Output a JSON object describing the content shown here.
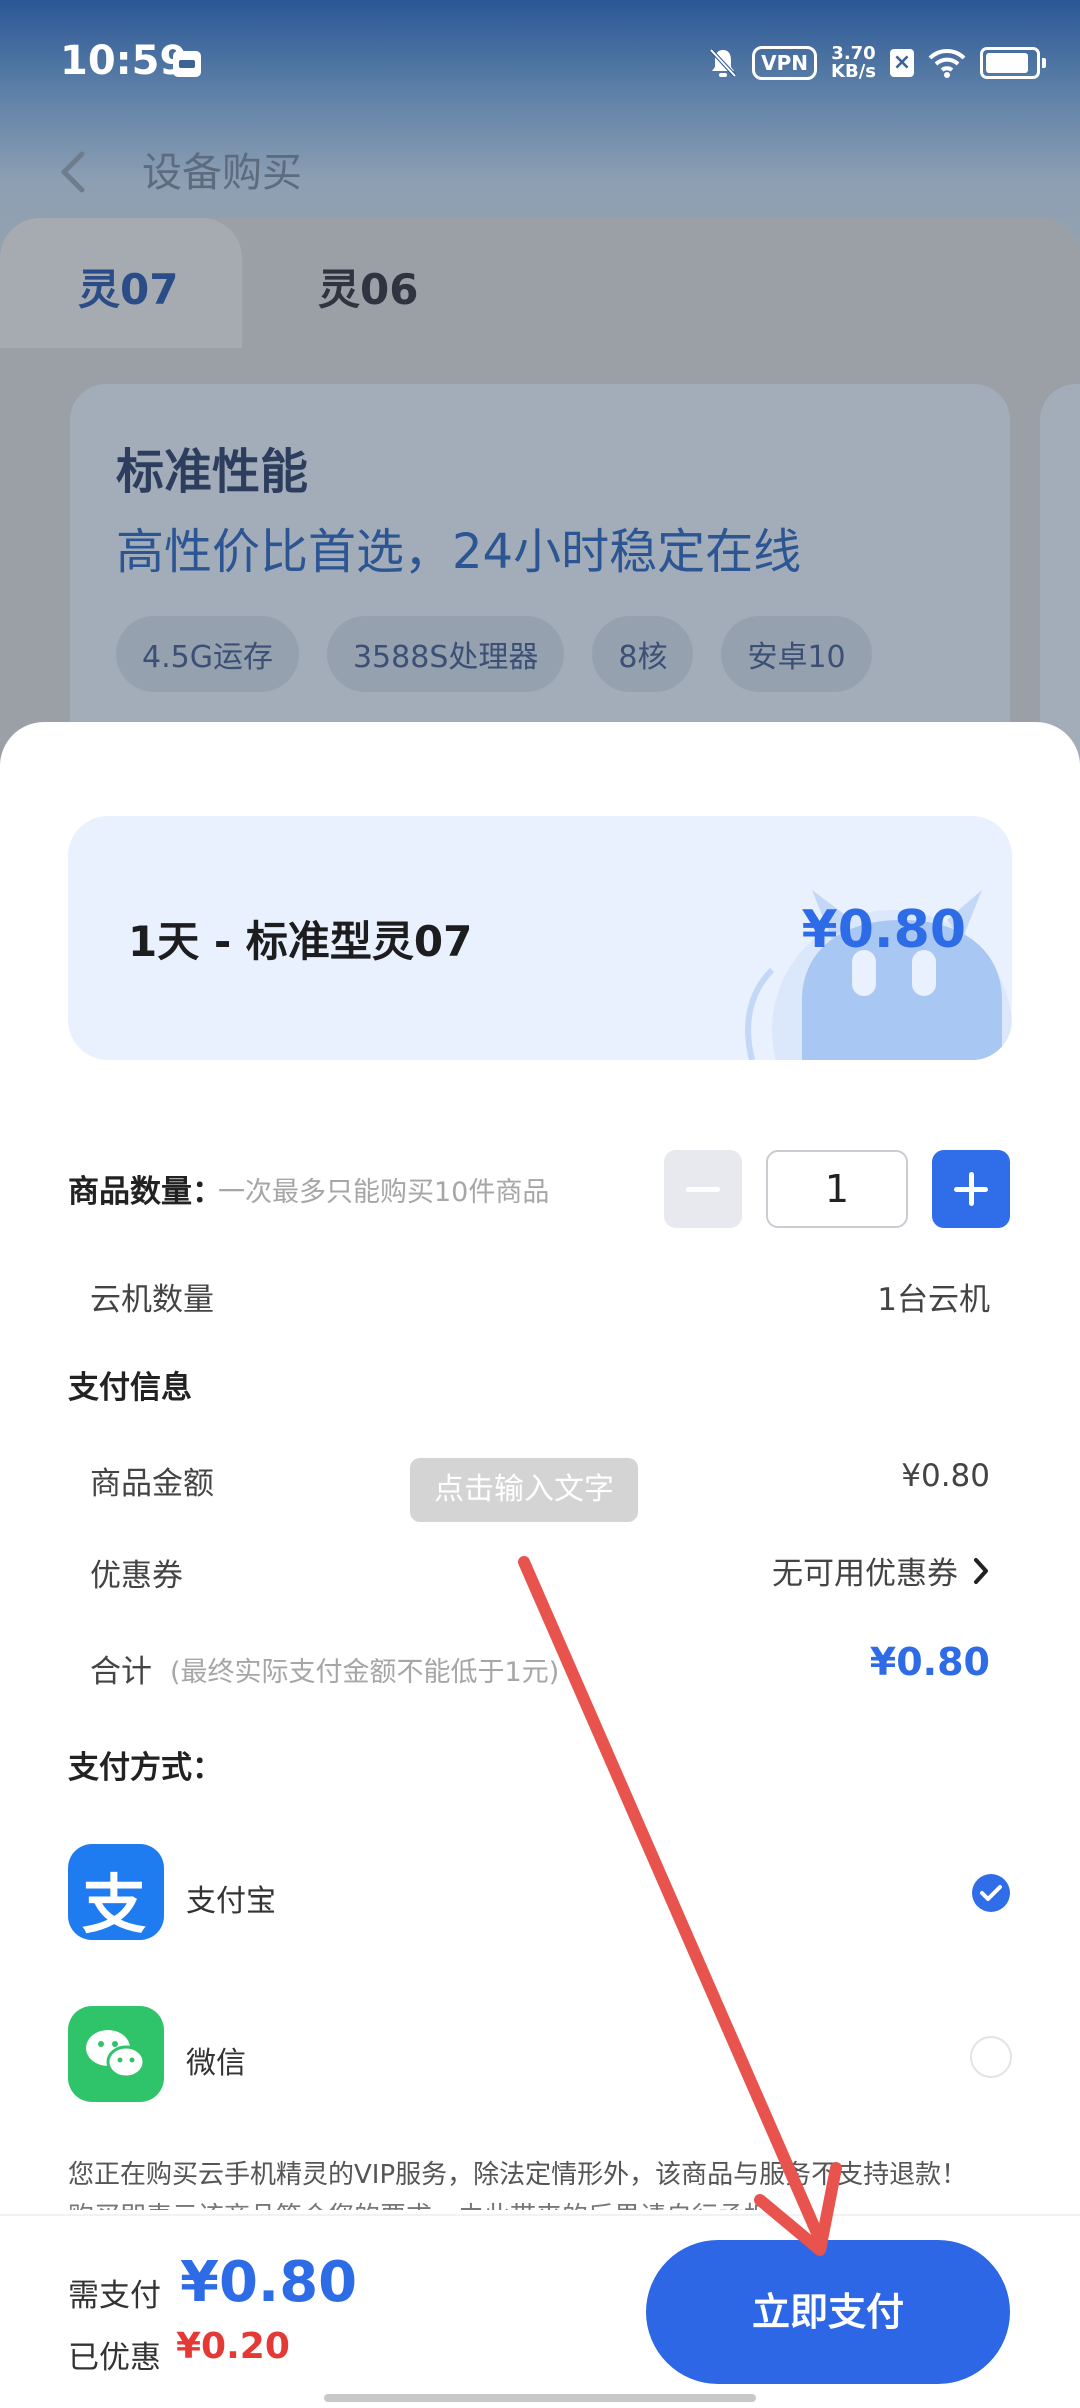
{
  "status_bar": {
    "time": "10:59",
    "vpn": "VPN",
    "speed_value": "3.70",
    "speed_unit": "KB/s"
  },
  "nav": {
    "title": "设备购买"
  },
  "tabs": [
    {
      "label": "灵07"
    },
    {
      "label": "灵06"
    }
  ],
  "plan": {
    "title": "标准性能",
    "subtitle": "高性价比首选，24小时稳定在线",
    "chips": [
      "4.5G运存",
      "3588S处理器",
      "8核",
      "安卓10"
    ]
  },
  "product": {
    "title": "1天 - 标准型灵07",
    "price": "¥0.80"
  },
  "quantity": {
    "label": "商品数量：",
    "hint": "一次最多只能购买10件商品",
    "value": "1"
  },
  "cloud_count": {
    "label": "云机数量",
    "value": "1台云机"
  },
  "payment_info": {
    "title": "支付信息",
    "amount_label": "商品金额",
    "amount_value": "¥0.80",
    "coupon_label": "优惠券",
    "coupon_value": "无可用优惠券",
    "total_label": "合计",
    "total_note": "(最终实际支付金额不能低于1元)",
    "total_value": "¥0.80"
  },
  "tooltip": "点击输入文字",
  "pay_methods": {
    "title": "支付方式：",
    "alipay": {
      "name": "支付宝",
      "icon_char": "支",
      "selected": true
    },
    "wechat": {
      "name": "微信",
      "selected": false
    }
  },
  "notice": "您正在购买云手机精灵的VIP服务，除法定情形外，该商品与服务不支持退款！",
  "notice_cut": "购买即表示该商品符合您的要求，由此带来的后果请自行承担",
  "footer": {
    "need_label": "需支付",
    "need_value": "¥0.80",
    "discount_label": "已优惠",
    "discount_value": "¥0.20",
    "pay_button": "立即支付"
  },
  "colors": {
    "accent": "#2e6be6",
    "discount": "#e53935",
    "annotation_arrow": "#e8534d"
  }
}
